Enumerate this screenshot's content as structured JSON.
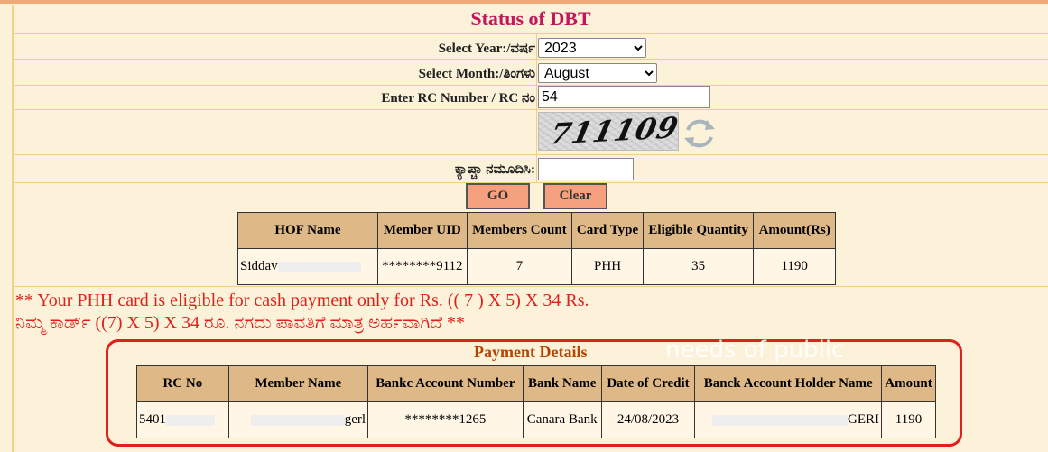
{
  "page": {
    "title": "Status of DBT"
  },
  "form": {
    "year_label": "Select Year:/ವರ್ಷ",
    "year_value": "2023",
    "month_label": "Select Month:/ತಿಂಗಳು",
    "month_value": "August",
    "rc_label": "Enter RC Number  / RC ನಂ",
    "rc_value": "54",
    "captcha_code": "711109",
    "captcha_label": "ಕ್ಯಾಪ್ಚಾ ನಮೂದಿಸಿ:",
    "captcha_input": "",
    "go_label": "GO",
    "clear_label": "Clear"
  },
  "summary_table": {
    "headers": [
      "HOF Name",
      "Member UID",
      "Members Count",
      "Card Type",
      "Eligible Quantity",
      "Amount(Rs)"
    ],
    "row": {
      "hof_name": "Siddav",
      "member_uid": "********9112",
      "members_count": "7",
      "card_type": "PHH",
      "eligible_quantity": "35",
      "amount": "1190"
    }
  },
  "eligibility": {
    "line_en": "** Your PHH card is eligible for cash payment only for Rs. (( 7 ) X 5) X 34 Rs.",
    "line_kn": "ನಿಮ್ಮ ಕಾರ್ಡ್ ((7) X 5) X 34 ರೂ. ನಗದು ಪಾವತಿಗೆ ಮಾತ್ರ ಅರ್ಹವಾಗಿದೆ **"
  },
  "payment": {
    "title": "Payment Details",
    "watermark": "needs of public",
    "headers": [
      "RC No",
      "Member Name",
      "Bankc Account Number",
      "Bank Name",
      "Date of Credit",
      "Banck Account Holder Name",
      "Amount"
    ],
    "row": {
      "rc_no": "5401",
      "member_name_tail": "gerl",
      "account_number": "********1265",
      "bank_name": "Canara Bank",
      "date_of_credit": "24/08/2023",
      "holder_tail": "GERI",
      "amount": "1190"
    }
  },
  "colors": {
    "title": "#c2185b",
    "alert": "#e0201a",
    "header_bg": "#deb887",
    "button_bg": "#f5a07e",
    "page_bg": "#fcf2da"
  }
}
